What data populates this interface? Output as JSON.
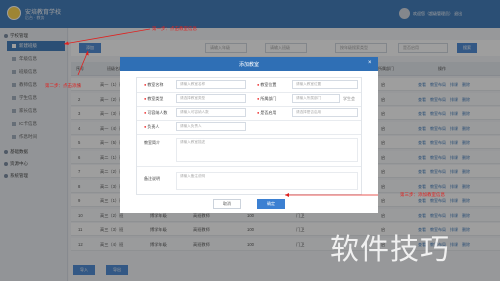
{
  "app": {
    "name": "安培教育学校",
    "subtitle": "后台 · 教务",
    "user": "欢迎您（超级管理员）  退出"
  },
  "sidebar": {
    "groups": [
      {
        "label": "学校管理",
        "items": [
          "新建班级",
          "年级信息",
          "班级信息",
          "教师信息",
          "学生信息",
          "家长信息",
          "IC卡信息",
          "作息时间"
        ]
      },
      {
        "label": "基础数据"
      },
      {
        "label": "资源中心"
      },
      {
        "label": "系统管理"
      }
    ]
  },
  "toolbar": {
    "add": "添加",
    "filter1": "请输入年级",
    "filter2": "请输入班级",
    "filter3": "按年级搜索类型",
    "filter4": "是否启用",
    "search": "搜索"
  },
  "table": {
    "headers": [
      "序号",
      "班级名称（年级）",
      "年级",
      "班主任",
      "人数",
      "教室",
      "所属部门",
      "操作"
    ],
    "rows": [
      {
        "no": "1",
        "name": "高一（1）班",
        "grade": "",
        "teacher": "",
        "count": "",
        "room": "",
        "status": "启",
        "actions": [
          "查看",
          "教室布局",
          "排课",
          "删除"
        ]
      },
      {
        "no": "2",
        "name": "高一（2）班",
        "grade": "",
        "teacher": "",
        "count": "",
        "room": "",
        "status": "启",
        "actions": [
          "查看",
          "教室布局",
          "排课",
          "删除"
        ]
      },
      {
        "no": "3",
        "name": "高一（3）班",
        "grade": "",
        "teacher": "",
        "count": "",
        "room": "",
        "status": "启",
        "actions": [
          "查看",
          "教室布局",
          "排课",
          "删除"
        ]
      },
      {
        "no": "4",
        "name": "高一（4）班",
        "grade": "",
        "teacher": "",
        "count": "",
        "room": "",
        "status": "启",
        "actions": [
          "查看",
          "教室布局",
          "排课",
          "删除"
        ]
      },
      {
        "no": "5",
        "name": "高一（5）班",
        "grade": "",
        "teacher": "",
        "count": "",
        "room": "",
        "status": "启",
        "actions": [
          "查看",
          "教室布局",
          "排课",
          "删除"
        ]
      },
      {
        "no": "6",
        "name": "高二（1）班",
        "grade": "",
        "teacher": "",
        "count": "",
        "room": "",
        "status": "启",
        "actions": [
          "查看",
          "教室布局",
          "排课",
          "删除"
        ]
      },
      {
        "no": "7",
        "name": "高二（2）班",
        "grade": "",
        "teacher": "",
        "count": "",
        "room": "",
        "status": "启",
        "actions": [
          "查看",
          "教室布局",
          "排课",
          "删除"
        ]
      },
      {
        "no": "8",
        "name": "高二（3）班",
        "grade": "",
        "teacher": "",
        "count": "",
        "room": "",
        "status": "启",
        "actions": [
          "查看",
          "教室布局",
          "排课",
          "删除"
        ]
      },
      {
        "no": "9",
        "name": "高三（1）班",
        "grade": "",
        "teacher": "",
        "count": "",
        "room": "",
        "status": "启",
        "actions": [
          "查看",
          "教室布局",
          "排课",
          "删除"
        ]
      },
      {
        "no": "10",
        "name": "高三（2）班",
        "grade": "博学年级",
        "teacher": "高班教师",
        "count": "100",
        "room": "门卫",
        "status": "启",
        "actions": [
          "查看",
          "教室布局",
          "排课",
          "删除"
        ]
      },
      {
        "no": "11",
        "name": "高三（3）班",
        "grade": "博学年级",
        "teacher": "高班教师",
        "count": "100",
        "room": "门卫",
        "status": "启",
        "actions": [
          "查看",
          "教室布局",
          "排课",
          "删除"
        ]
      },
      {
        "no": "12",
        "name": "高三（4）班",
        "grade": "博学年级",
        "teacher": "高班教师",
        "count": "100",
        "room": "门卫",
        "status": "启",
        "actions": [
          "查看",
          "教室布局",
          "排课",
          "删除"
        ]
      }
    ]
  },
  "footer": {
    "import": "导入",
    "export": "导出"
  },
  "modal": {
    "title": "添加教室",
    "fields": {
      "name_label": "教室名称",
      "name_ph": "请输入教室名称",
      "location_label": "教室位置",
      "location_ph": "请输入教室位置",
      "type_label": "教室类型",
      "type_ph": "请选择教室类型",
      "dept_label": "所属部门",
      "dept_ph": "请输入所属部门",
      "dept_unit": "学生会",
      "capacity_label": "可容纳人数",
      "capacity_ph": "请输入可容纳人数",
      "status_label": "是否启用",
      "status_ph": "请选择是否启用",
      "manager_label": "负责人",
      "manager_ph": "请输入负责人",
      "desc_label": "教室简介",
      "desc_ph": "请输入教室描述",
      "note_label": "备注说明",
      "note_ph": "请输入备注说明"
    },
    "cancel": "取消",
    "ok": "确定"
  },
  "annotations": {
    "step1": "第一步：点击教室信息",
    "step2": "第二步：点击添加",
    "step3": "第三步：添加教室信息"
  },
  "watermark": "软件技巧",
  "colors": {
    "primary": "#2f6fb5",
    "button": "#3c80d2",
    "annotation": "#e0201e"
  }
}
